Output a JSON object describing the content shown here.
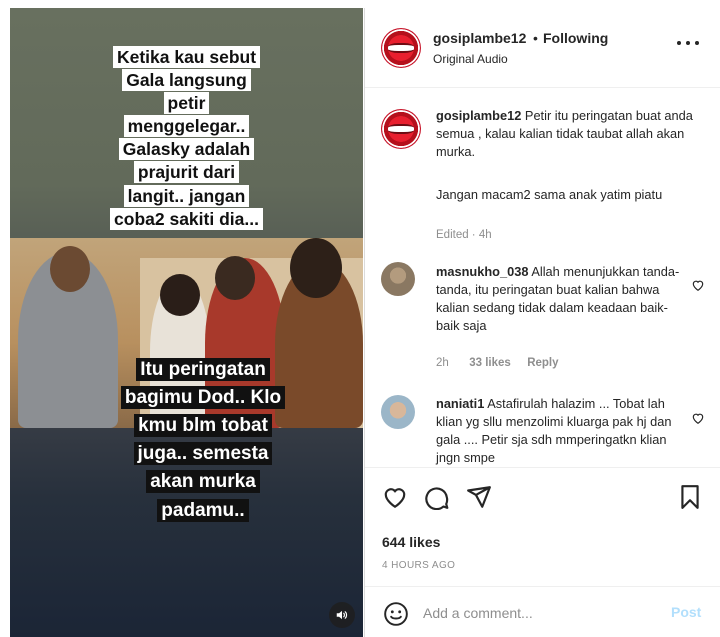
{
  "video": {
    "caption_top_lines": [
      "Ketika kau sebut",
      "Gala langsung",
      "petir",
      "menggelegar..",
      "Galasky adalah",
      "prajurit dari",
      "langit.. jangan",
      "coba2 sakiti dia..."
    ],
    "caption_bottom_lines": [
      "Itu peringatan",
      "bagimu Dod.. Klo",
      "kmu blm tobat",
      "juga.. semesta",
      "akan murka",
      "padamu.."
    ],
    "sound_icon": "speaker-icon"
  },
  "header": {
    "username": "gosiplambe12",
    "separator": "•",
    "follow_status": "Following",
    "audio": "Original Audio"
  },
  "caption": {
    "username": "gosiplambe12",
    "text": "Petir itu peringatan buat anda semua , kalau kalian tidak taubat allah akan murka.",
    "text2": "Jangan macam2 sama anak yatim piatu",
    "meta": "Edited · 4h"
  },
  "comments": [
    {
      "username": "masnukho_038",
      "text": "Allah menunjukkan tanda-tanda, itu peringatan buat kalian bahwa kalian sedang tidak dalam keadaan baik-baik saja",
      "time": "2h",
      "likes": "33 likes",
      "reply": "Reply"
    },
    {
      "username": "naniati1",
      "text": "Astafirulah halazim ... Tobat lah klian yg sllu menzolimi kluarga pak hj dan gala .... Petir sja sdh mmperingatkn klian jngn smpe"
    }
  ],
  "actions": {
    "likes": "644 likes",
    "time_ago": "4 HOURS AGO",
    "comment_placeholder": "Add a comment...",
    "post_label": "Post"
  },
  "colors": {
    "post_disabled": "#b2dffc",
    "muted": "#8e8e8e",
    "text": "#262626",
    "avatar_red": "#e81f2e"
  }
}
